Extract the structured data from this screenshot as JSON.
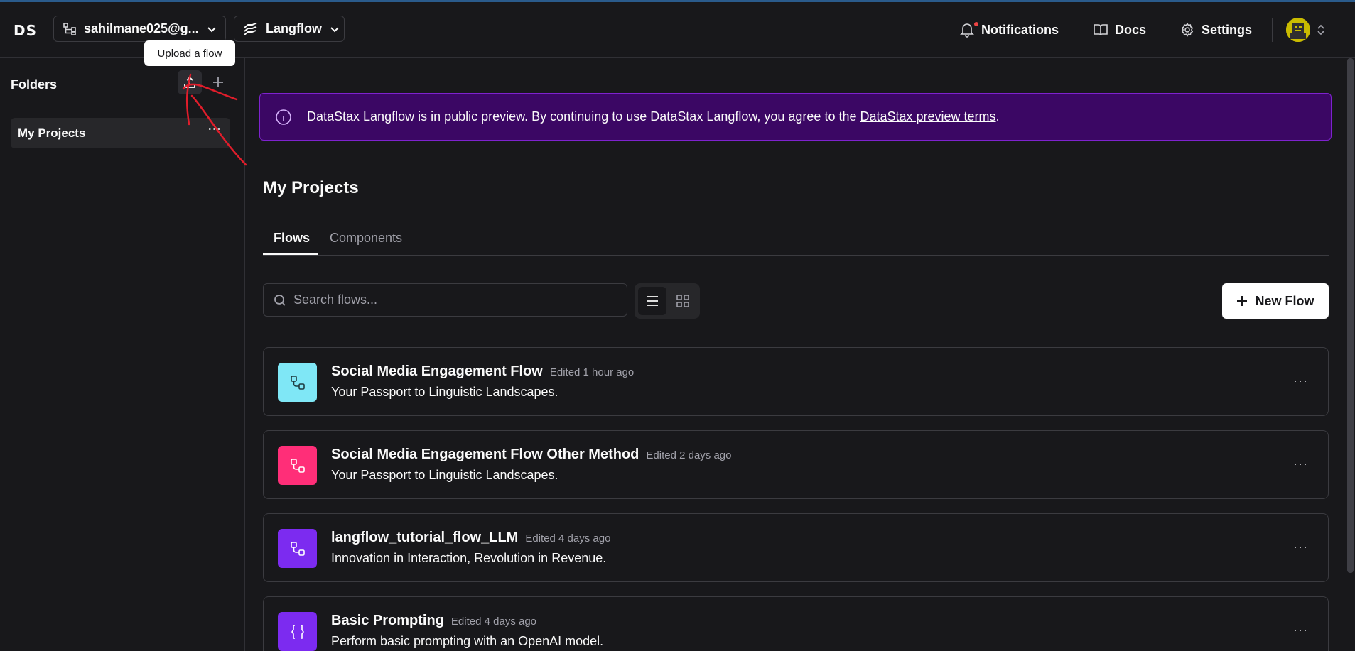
{
  "header": {
    "logo": "DS",
    "org": "sahilmane025@g...",
    "project": "Langflow",
    "notifications": "Notifications",
    "docs": "Docs",
    "settings": "Settings"
  },
  "sidebar": {
    "title": "Folders",
    "tooltip": "Upload a flow",
    "folders": [
      {
        "label": "My Projects",
        "more": "···"
      }
    ]
  },
  "banner": {
    "text": "DataStax Langflow is in public preview. By continuing to use DataStax Langflow, you agree to the",
    "link": "DataStax preview terms",
    "suffix": "."
  },
  "main": {
    "title": "My Projects",
    "tabs": [
      {
        "label": "Flows"
      },
      {
        "label": "Components"
      }
    ],
    "search_placeholder": "Search flows...",
    "new_flow": "New Flow"
  },
  "flows": [
    {
      "title": "Social Media Engagement Flow",
      "edited": "Edited 1 hour ago",
      "desc": "Your Passport to Linguistic Landscapes.",
      "icon": "flow-icon",
      "color": "#7fe7f6"
    },
    {
      "title": "Social Media Engagement Flow Other Method",
      "edited": "Edited 2 days ago",
      "desc": "Your Passport to Linguistic Landscapes.",
      "icon": "flow-icon",
      "color": "#ff2e78"
    },
    {
      "title": "langflow_tutorial_flow_LLM",
      "edited": "Edited 4 days ago",
      "desc": "Innovation in Interaction, Revolution in Revenue.",
      "icon": "flow-icon",
      "color": "#7c2bf0"
    },
    {
      "title": "Basic Prompting",
      "edited": "Edited 4 days ago",
      "desc": "Perform basic prompting with an OpenAI model.",
      "icon": "braces-icon",
      "color": "#7c2bf0"
    }
  ],
  "more_glyph": "···"
}
